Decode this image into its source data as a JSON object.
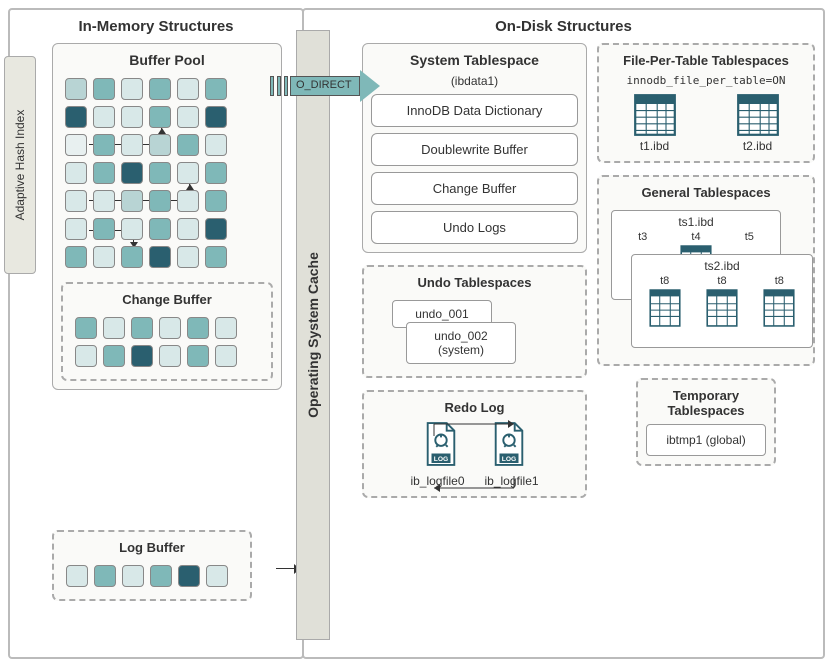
{
  "titles": {
    "inMemory": "In-Memory Structures",
    "onDisk": "On-Disk Structures",
    "bufferPool": "Buffer Pool",
    "adaptiveHashIndex": "Adaptive Hash Index",
    "changeBuffer": "Change Buffer",
    "logBuffer": "Log Buffer",
    "osCache": "Operating System Cache",
    "oDirect": "O_DIRECT",
    "systemTablespace": "System Tablespace",
    "systemTablespaceSub": "(ibdata1)",
    "innodbDict": "InnoDB Data Dictionary",
    "doublewrite": "Doublewrite Buffer",
    "changeBufferDisk": "Change Buffer",
    "undoLogs": "Undo Logs",
    "undoTablespaces": "Undo Tablespaces",
    "undo1": "undo_001",
    "undo2": "undo_002 (system)",
    "redoLog": "Redo Log",
    "redoFile1": "ib_logfile0",
    "redoFile2": "ib_logfile1",
    "filePerTable": "File-Per-Table Tablespaces",
    "filePerTableSub": "innodb_file_per_table=ON",
    "t1": "t1.ibd",
    "t2": "t2.ibd",
    "generalTablespaces": "General Tablespaces",
    "ts1": "ts1.ibd",
    "ts2": "ts2.ibd",
    "t3": "t3",
    "t4": "t4",
    "t5": "t5",
    "t8": "t8",
    "tempTablespaces": "Temporary Tablespaces",
    "ibtmp": "ibtmp1 (global)"
  },
  "bufferPool": {
    "rows": 7,
    "cols": 6,
    "cells": [
      [
        "c1",
        "c2",
        "c3",
        "c2",
        "c3",
        "c2"
      ],
      [
        "c4",
        "c3",
        "c3",
        "c2",
        "c3",
        "c4"
      ],
      [
        "c5",
        "c2",
        "c3",
        "c1",
        "c2",
        "c3"
      ],
      [
        "c3",
        "c2",
        "c4",
        "c2",
        "c3",
        "c2"
      ],
      [
        "c3",
        "c3",
        "c1",
        "c2",
        "c3",
        "c2"
      ],
      [
        "c3",
        "c2",
        "c3",
        "c2",
        "c3",
        "c4"
      ],
      [
        "c2",
        "c3",
        "c2",
        "c4",
        "c3",
        "c2"
      ]
    ]
  },
  "changeBuffer": {
    "cells": [
      [
        "c2",
        "c3",
        "c2",
        "c3",
        "c2",
        "c3"
      ],
      [
        "c3",
        "c2",
        "c4",
        "c3",
        "c2",
        "c3"
      ]
    ]
  },
  "logBuffer": {
    "cells": [
      "c3",
      "c2",
      "c3",
      "c2",
      "c4",
      "c3"
    ]
  }
}
